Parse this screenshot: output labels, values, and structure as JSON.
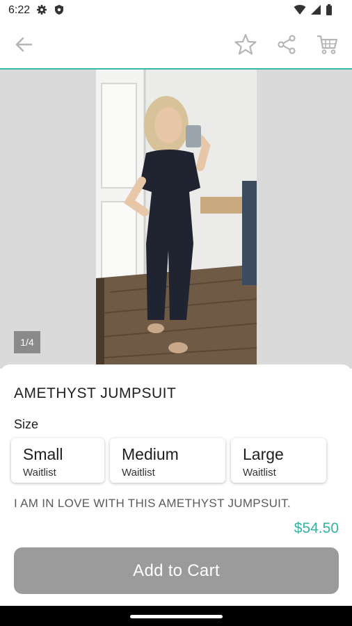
{
  "status_bar": {
    "time": "6:22",
    "left_icons": [
      "gear-icon",
      "shield-icon"
    ],
    "right_icons": [
      "wifi-icon",
      "signal-icon",
      "battery-icon"
    ]
  },
  "app_bar": {
    "icons": [
      "back-arrow-icon",
      "star-icon",
      "share-icon",
      "cart-icon"
    ],
    "accent_color": "#38b8a6"
  },
  "gallery": {
    "counter": "1/4"
  },
  "product": {
    "title": "AMETHYST JUMPSUIT",
    "size_label": "Size",
    "sizes": [
      {
        "name": "Small",
        "status": "Waitlist"
      },
      {
        "name": "Medium",
        "status": "Waitlist"
      },
      {
        "name": "Large",
        "status": "Waitlist"
      }
    ],
    "description": "I AM IN LOVE WITH THIS AMETHYST JUMPSUIT."
  },
  "footer": {
    "price": "$54.50",
    "price_color": "#33b3a0",
    "add_to_cart_label": "Add to Cart",
    "button_color": "#9b9b9b"
  }
}
